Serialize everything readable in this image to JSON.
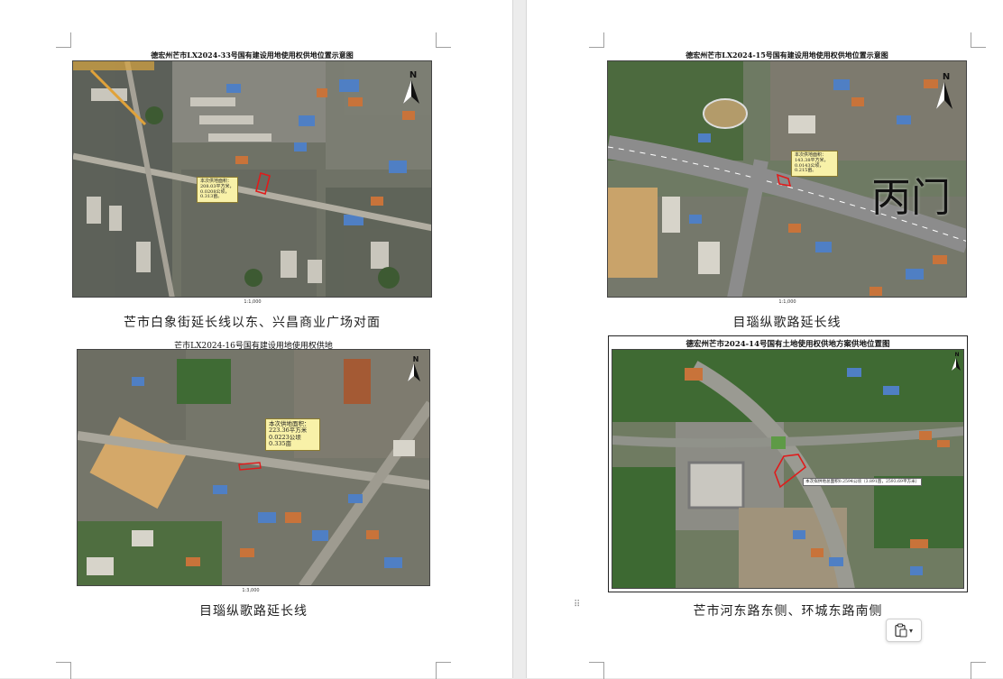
{
  "map1": {
    "title": "德宏州芒市LX2024-33号国有建设用地使用权供地位置示意图",
    "callout": [
      "本次供地面积：",
      "208.03平方米，",
      "0.0208公顷，",
      "0.313亩。"
    ],
    "scale": "1:1,000",
    "caption": "芒市白象街延长线以东、兴昌商业广场对面"
  },
  "map2": {
    "title": "德宏州芒市LX2024-15号国有建设用地使用权供地位置示意图",
    "callout": [
      "本次供地面积：",
      "143.38平方米，",
      "0.0143公顷，",
      "0.215亩。"
    ],
    "overlay_text": "丙门",
    "scale": "1:1,000",
    "caption": "目瑙纵歌路延长线"
  },
  "map3": {
    "title": "芒市LX2024-16号国有建设用地使用权供地",
    "callout": [
      "本次供地面积：",
      "223.36平方米",
      "0.0223公顷",
      "0.335亩"
    ],
    "scale": "1:3,000",
    "caption": "目瑙纵歌路延长线"
  },
  "map4": {
    "title": "德宏州芒市2024-14号国有土地使用权供地方案供地位置图",
    "callout": [
      "本次拟供地总面积0.2594公顷（3.891亩，2593.69平方米）"
    ],
    "caption": "芒市河东路东侧、环城东路南侧"
  },
  "north_letter": "N",
  "colors": {
    "parcel": "#e01b1b",
    "callout_bg": "#f8f1a8"
  },
  "icons": {
    "paste": "clipboard-icon",
    "dropdown": "chevron-down-icon",
    "drag": "drag-handle-icon"
  }
}
